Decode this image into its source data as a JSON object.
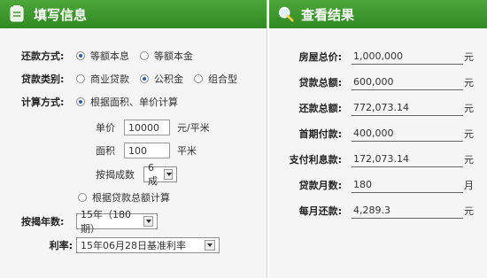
{
  "left": {
    "title": "填写信息",
    "repay_label": "还款方式:",
    "repay_options": [
      "等额本息",
      "等额本金"
    ],
    "loan_type_label": "贷款类别:",
    "loan_types": [
      "商业贷款",
      "公积金",
      "组合型"
    ],
    "calc_label": "计算方式:",
    "calc_by_area": "根据面积、单价计算",
    "price_label": "单价",
    "price_value": "10000",
    "price_unit": "元/平米",
    "area_label": "面积",
    "area_value": "100",
    "area_unit": "平米",
    "ratio_label": "按揭成数",
    "ratio_value": "6成",
    "calc_by_total": "根据贷款总额计算",
    "years_label": "按揭年数:",
    "years_value": "15年（180期）",
    "rate_label": "利率:",
    "rate_value": "15年06月28日基准利率"
  },
  "right": {
    "title": "查看结果",
    "results": [
      {
        "label": "房屋总价:",
        "value": "1,000,000",
        "unit": "元"
      },
      {
        "label": "贷款总额:",
        "value": "600,000",
        "unit": "元"
      },
      {
        "label": "还款总额:",
        "value": "772,073.14",
        "unit": "元"
      },
      {
        "label": "首期付款:",
        "value": "400,000",
        "unit": "元"
      },
      {
        "label": "支付利息款:",
        "value": "172,073.14",
        "unit": "元"
      },
      {
        "label": "贷款月数:",
        "value": "180",
        "unit": "月"
      },
      {
        "label": "每月还款:",
        "value": "4,289.3",
        "unit": "元"
      }
    ]
  },
  "icons": {
    "form": "document-icon",
    "result": "magnifier-icon"
  },
  "colors": {
    "header": "#3d9a2f",
    "panel_bg": "#f5f5f5",
    "radio_on": "#2a5fa8"
  }
}
